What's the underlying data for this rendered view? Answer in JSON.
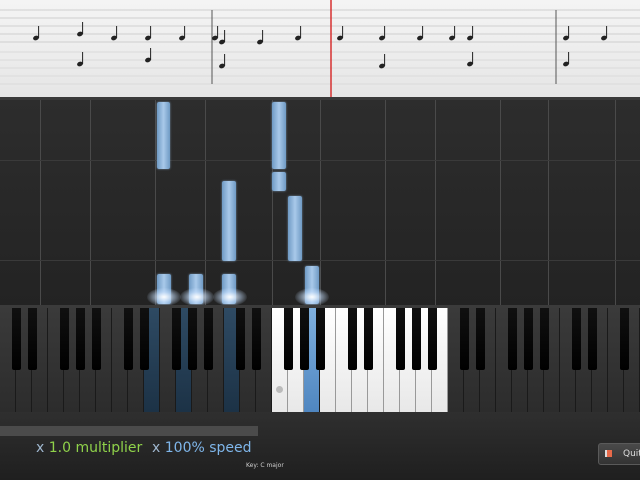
{
  "app": {
    "multiplier_prefix": "x",
    "multiplier_value": "1.0 multiplier",
    "speed_prefix": "x",
    "speed_value": "100% speed",
    "key_text": "Key: C major",
    "quit_label": "Quit"
  },
  "keyboard": {
    "white_key_count": 40,
    "lit_white_keys": [
      17,
      18,
      20,
      21,
      22,
      23,
      24,
      25,
      26,
      27
    ],
    "pressed_white_keys": [
      19
    ],
    "deep_pressed_white_keys": [
      9,
      11,
      14
    ],
    "black_keys_visible": true
  },
  "notes": {
    "note_color": "#8fb6dd",
    "glow_color": "#ffffff"
  },
  "colors": {
    "multiplier": "#8fd24a",
    "speed": "#7fb6ea",
    "playhead": "#d63030"
  },
  "icons": {
    "quit": "exit-door-icon"
  }
}
